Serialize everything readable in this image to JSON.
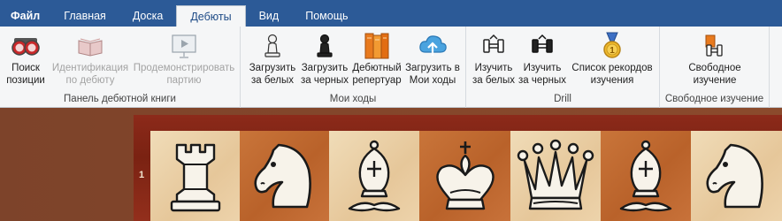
{
  "menu": {
    "file": "Файл",
    "tabs": [
      "Главная",
      "Доска",
      "Дебюты",
      "Вид",
      "Помощь"
    ],
    "active_tab": "Дебюты"
  },
  "ribbon": {
    "groups": [
      {
        "label": "Панель дебютной книги",
        "buttons": [
          {
            "lines": [
              "Поиск",
              "позиции"
            ],
            "icon": "binoculars-icon",
            "enabled": true
          },
          {
            "lines": [
              "Идентификация",
              "по дебюту"
            ],
            "icon": "book-icon",
            "enabled": false
          },
          {
            "lines": [
              "Продемонстрировать",
              "партию"
            ],
            "icon": "play-presentation-icon",
            "enabled": false
          }
        ]
      },
      {
        "label": "Мои ходы",
        "buttons": [
          {
            "lines": [
              "Загрузить",
              "за белых"
            ],
            "icon": "white-pawn-icon",
            "enabled": true
          },
          {
            "lines": [
              "Загрузить",
              "за черных"
            ],
            "icon": "black-pawn-icon",
            "enabled": true
          },
          {
            "lines": [
              "Дебютный",
              "репертуар"
            ],
            "icon": "books-icon",
            "enabled": true
          },
          {
            "lines": [
              "Загрузить в",
              "Мои ходы"
            ],
            "icon": "cloud-upload-icon",
            "enabled": true
          }
        ]
      },
      {
        "label": "Drill",
        "buttons": [
          {
            "lines": [
              "Изучить",
              "за белых"
            ],
            "icon": "white-dumbbell-icon",
            "enabled": true
          },
          {
            "lines": [
              "Изучить",
              "за черных"
            ],
            "icon": "black-dumbbell-icon",
            "enabled": true
          },
          {
            "lines": [
              "Список рекордов",
              "изучения"
            ],
            "icon": "medal-icon",
            "enabled": true
          }
        ]
      },
      {
        "label": "Свободное изучение",
        "buttons": [
          {
            "lines": [
              "Свободное",
              "изучение"
            ],
            "icon": "free-study-icon",
            "enabled": true
          }
        ]
      }
    ]
  },
  "board": {
    "rank": "1",
    "pieces": [
      "white-rook",
      "white-knight",
      "white-bishop",
      "white-king",
      "white-queen",
      "white-bishop",
      "white-knight"
    ]
  },
  "colors": {
    "menubar": "#2c5a97",
    "ribbon": "#f5f6f7",
    "light_square": "#f0dcb8",
    "dark_square": "#c9753a",
    "frame": "#8c2a1a"
  }
}
